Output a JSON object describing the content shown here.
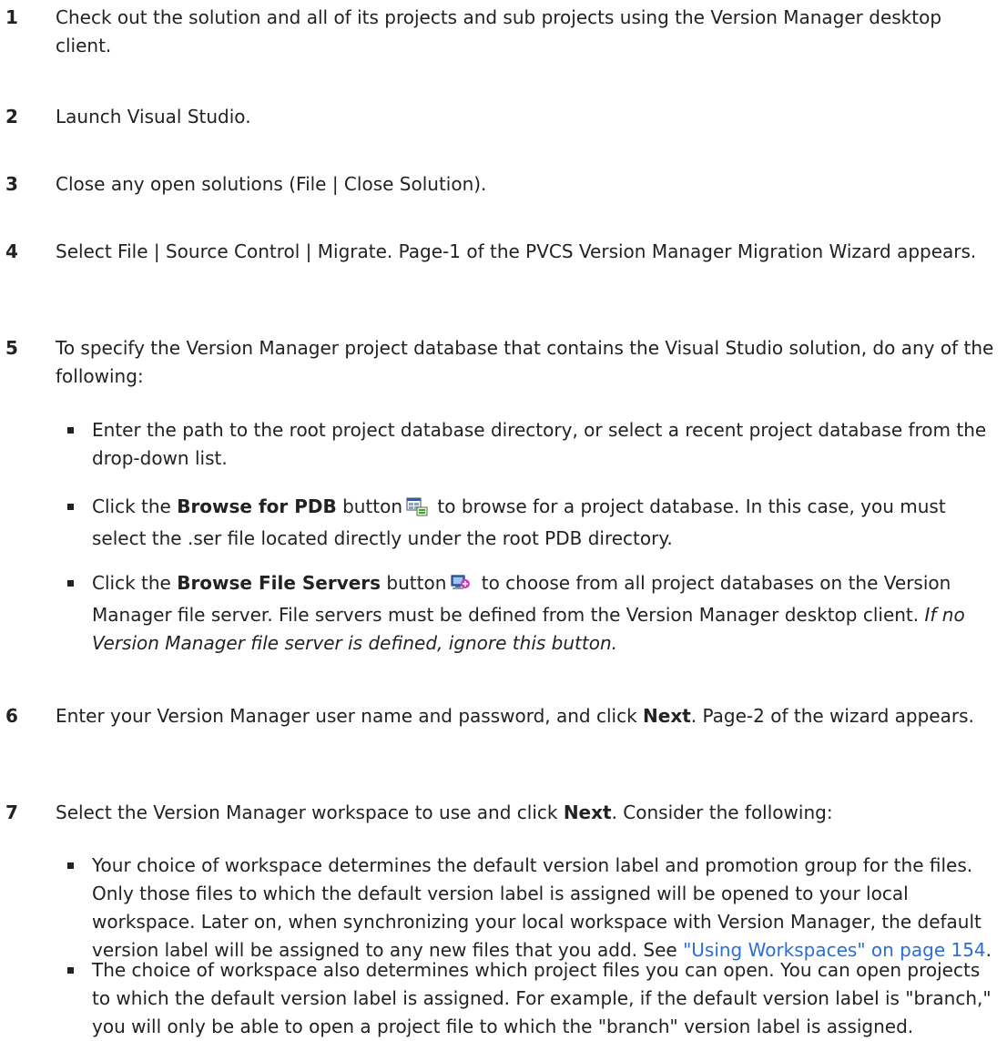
{
  "steps": [
    {
      "num": "1",
      "text": "Check out the solution and all of its projects and sub projects using the Version Manager desktop client."
    },
    {
      "num": "2",
      "text": "Launch Visual Studio."
    },
    {
      "num": "3",
      "text": "Close any open solutions (File | Close Solution)."
    },
    {
      "num": "4",
      "text": "Select File | Source Control | Migrate. Page-1 of the PVCS Version Manager Migration Wizard appears."
    },
    {
      "num": "5",
      "text": "To specify the Version Manager project database that contains the Visual Studio solution, do any of the following:"
    },
    {
      "num": "6",
      "text_a": "Enter your Version Manager user name and password, and click ",
      "bold": "Next",
      "text_b": ". Page-2 of the wizard appears."
    },
    {
      "num": "7",
      "text_a": "Select the Version Manager workspace to use and click ",
      "bold": "Next",
      "text_b": ". Consider the following:"
    }
  ],
  "step5_bullets": {
    "b1": "Enter the path to the root project database directory, or select a recent project database from the drop-down list.",
    "b2_a": "Click the ",
    "b2_bold": "Browse for PDB",
    "b2_b": " button",
    "b2_c": " to browse for a project database. In this case, you must select the .ser file located directly under the root PDB directory.",
    "b3_a": "Click the ",
    "b3_bold": "Browse File Servers",
    "b3_b": " button",
    "b3_c": " to choose from all project databases on the Version Manager file server. File servers must be defined from the Version Manager desktop client. ",
    "b3_italic": "If no Version Manager file server is defined, ignore this button."
  },
  "step7_bullets": {
    "b1_a": "Your choice of workspace determines the default version label and promotion group for the files. Only those files to which the default version label is assigned will be opened to your local workspace. Later on, when synchronizing your local workspace with Version Manager, the default version label will be assigned to any new files that you add. See ",
    "b1_link": "\"Using Workspaces\" on page 154",
    "b1_b": ".",
    "b2": "The choice of workspace also determines which project files you can open. You can open projects to which the default version label is assigned. For example, if the default version label is \"branch,\" you will only be able to open a project file to which the \"branch\" version label is assigned."
  },
  "icons": {
    "browse_pdb": "browse-pdb-icon",
    "browse_file_servers": "browse-file-servers-icon"
  },
  "colors": {
    "text": "#222222",
    "link": "#2a6ed6"
  }
}
